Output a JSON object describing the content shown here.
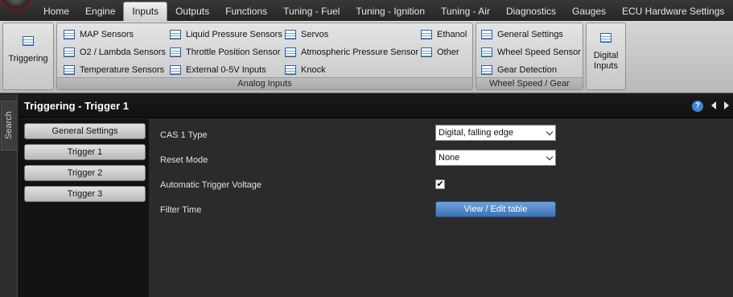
{
  "menu": {
    "tabs": [
      "Home",
      "Engine",
      "Inputs",
      "Outputs",
      "Functions",
      "Tuning - Fuel",
      "Tuning - Ignition",
      "Tuning - Air",
      "Diagnostics",
      "Gauges",
      "ECU Hardware Settings"
    ],
    "active_tab": "Inputs"
  },
  "ribbon": {
    "triggering": "Triggering",
    "analog_inputs": {
      "group_label": "Analog Inputs",
      "col1": [
        "MAP Sensors",
        "O2 / Lambda Sensors",
        "Temperature Sensors"
      ],
      "col2": [
        "Liquid Pressure Sensors",
        "Throttle Position Sensor",
        "External 0-5V Inputs"
      ],
      "col3": [
        "Servos",
        "Atmospheric Pressure Sensor",
        "Knock"
      ],
      "col4": [
        "Ethanol",
        "Other"
      ]
    },
    "wheel_speed": {
      "group_label": "Wheel Speed / Gear",
      "items": [
        "General Settings",
        "Wheel Speed Sensor",
        "Gear Detection"
      ]
    },
    "digital_inputs": {
      "line1": "Digital",
      "line2": "Inputs"
    }
  },
  "search_label": "Search",
  "page": {
    "title": "Triggering - Trigger 1",
    "help_glyph": "?",
    "side_buttons": [
      "General Settings",
      "Trigger 1",
      "Trigger 2",
      "Trigger 3"
    ],
    "fields": {
      "cas_type": {
        "label": "CAS 1 Type",
        "value": "Digital, falling edge"
      },
      "reset_mode": {
        "label": "Reset Mode",
        "value": "None"
      },
      "auto_trigger_voltage": {
        "label": "Automatic Trigger Voltage",
        "checked": true,
        "check_glyph": "✔"
      },
      "filter_time": {
        "label": "Filter Time",
        "button": "View / Edit table"
      }
    }
  },
  "colors": {
    "accent_blue": "#3a72b8",
    "title_bar": "#111111",
    "panel_bg": "#2b2b2b"
  }
}
